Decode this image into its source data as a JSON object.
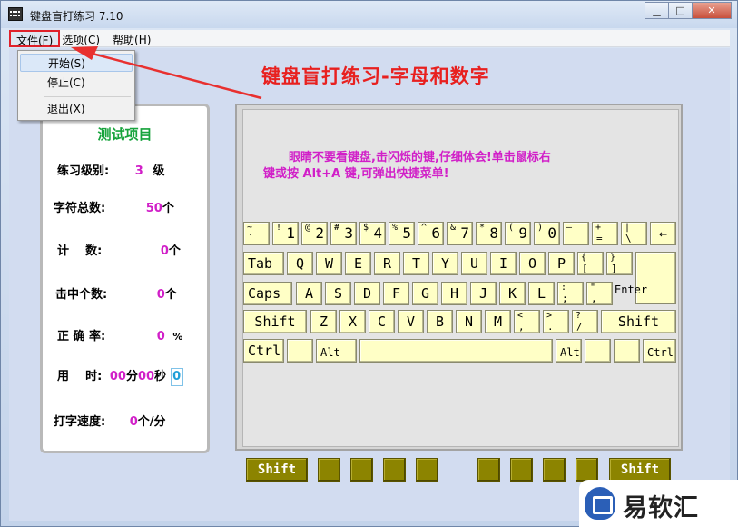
{
  "window": {
    "title": "键盘盲打练习 7.10",
    "min": "▁",
    "max": "□",
    "close": "✕"
  },
  "menubar": {
    "file": "文件(F)",
    "options": "选项(C)",
    "help": "帮助(H)"
  },
  "dropdown": {
    "start": "开始(S)",
    "stop": "停止(C)",
    "exit": "退出(X)"
  },
  "main_title": "键盘盲打练习-字母和数字",
  "stats": {
    "title": "测试项目",
    "level_label": "练习级别:",
    "level_value": "3",
    "level_unit": "级",
    "total_label": "字符总数:",
    "total_value": "50",
    "total_unit": "个",
    "count_label": "计    数:",
    "count_value": "0",
    "count_unit": "个",
    "hit_label": "击中个数:",
    "hit_value": "0",
    "hit_unit": "个",
    "acc_label": "正 确 率:",
    "acc_value": "0",
    "acc_unit": "%",
    "time_label": "用    时:",
    "time_min": "00",
    "time_min_unit": "分",
    "time_sec": "00",
    "time_sec_unit": "秒",
    "time_box": "0",
    "speed_label": "打字速度:",
    "speed_value": "0",
    "speed_unit": "个/分"
  },
  "hint": {
    "line1": "眼睛不要看键盘,击闪烁的键,仔细体会!单击鼠标右",
    "line2": "键或按 Alt+A 键,可弹出快捷菜单!"
  },
  "keys": {
    "row1": [
      {
        "t": "~",
        "b": "`"
      },
      {
        "t": "!",
        "m": "1"
      },
      {
        "t": "@",
        "m": "2"
      },
      {
        "t": "#",
        "m": "3"
      },
      {
        "t": "$",
        "m": "4"
      },
      {
        "t": "%",
        "m": "5"
      },
      {
        "t": "^",
        "m": "6"
      },
      {
        "t": "&",
        "m": "7"
      },
      {
        "t": "*",
        "m": "8"
      },
      {
        "t": "(",
        "m": "9"
      },
      {
        "t": ")",
        "m": "0"
      },
      {
        "t": "—",
        "b": "_"
      },
      {
        "t": "+",
        "b": "="
      },
      {
        "t": "|",
        "b": "\\"
      },
      {
        "c": "←"
      }
    ],
    "row2": [
      "Tab",
      "Q",
      "W",
      "E",
      "R",
      "T",
      "Y",
      "U",
      "I",
      "O",
      "P"
    ],
    "row2_br1": {
      "t": "{",
      "b": "["
    },
    "row2_br2": {
      "t": "}",
      "b": "]"
    },
    "enter": "Enter",
    "row3": [
      "Caps",
      "A",
      "S",
      "D",
      "F",
      "G",
      "H",
      "J",
      "K",
      "L"
    ],
    "row3_p1": {
      "t": ":",
      "b": ";"
    },
    "row3_p2": {
      "t": "\"",
      "b": ","
    },
    "row4": [
      "Shift",
      "Z",
      "X",
      "C",
      "V",
      "B",
      "N",
      "M"
    ],
    "row4_p1": {
      "t": "<",
      "b": ","
    },
    "row4_p2": {
      "t": ">",
      "b": "."
    },
    "row4_p3": {
      "t": "?",
      "b": "/"
    },
    "row4_shift_r": "Shift",
    "row5": {
      "ctrl_l": "Ctrl",
      "alt_l": "Alt",
      "alt_r": "Alt",
      "ctrl_r": "Ctrl"
    }
  },
  "finger_keys": {
    "shift_l": "Shift",
    "shift_r": "Shift"
  },
  "watermark": "易软汇"
}
